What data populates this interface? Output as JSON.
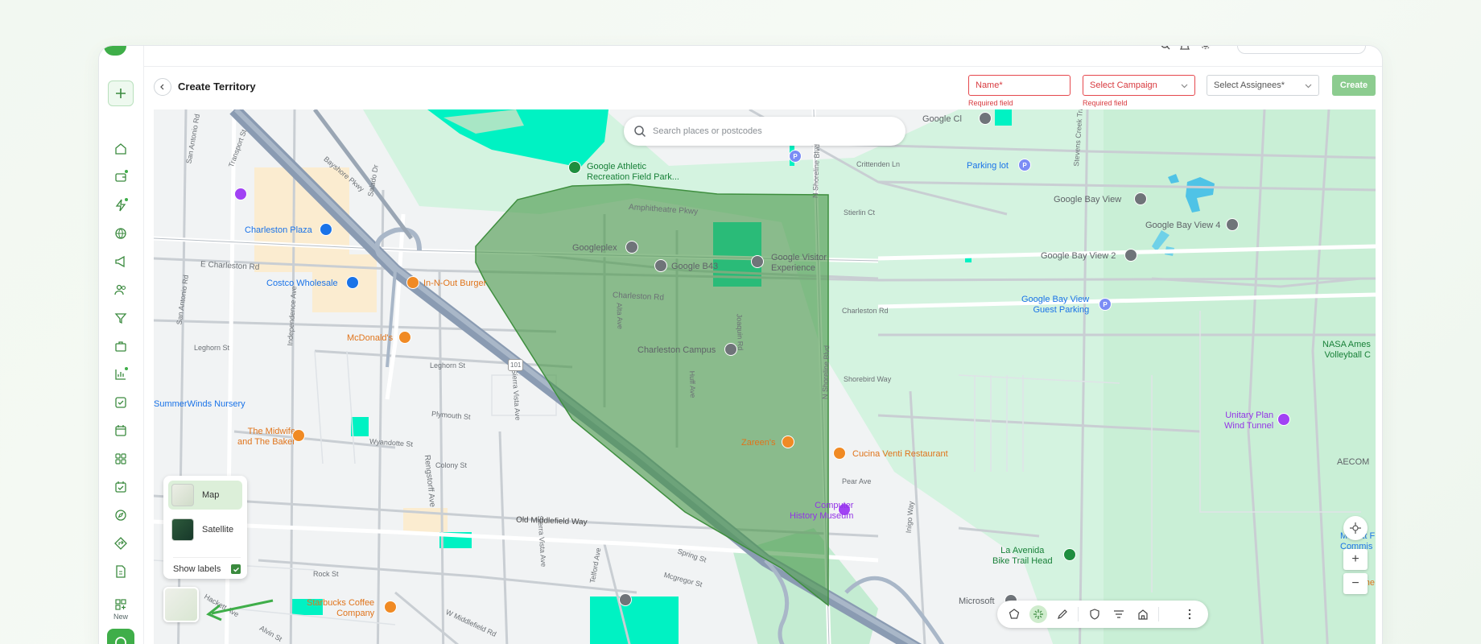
{
  "header": {
    "title": "Create Territory",
    "name_placeholder": "Name*",
    "name_error": "Required field",
    "campaign_placeholder": "Select Campaign",
    "campaign_error": "Required field",
    "assignees_placeholder": "Select Assignees*",
    "create_label": "Create"
  },
  "sidebar": {
    "items": [
      {
        "icon": "home-icon"
      },
      {
        "icon": "wallet-icon",
        "badge": true
      },
      {
        "icon": "lightning-icon",
        "badge": true
      },
      {
        "icon": "globe-icon"
      },
      {
        "icon": "megaphone-icon"
      },
      {
        "icon": "users-icon"
      },
      {
        "icon": "filter-icon"
      },
      {
        "icon": "briefcase-icon"
      },
      {
        "icon": "chart-icon",
        "badge": true
      },
      {
        "icon": "checkbox-icon"
      },
      {
        "icon": "calendar-icon"
      },
      {
        "icon": "grid-icon"
      },
      {
        "icon": "calendar-check-icon"
      },
      {
        "icon": "compass-icon"
      },
      {
        "icon": "directions-icon"
      },
      {
        "icon": "document-icon"
      }
    ],
    "new_label": "New"
  },
  "map": {
    "search_placeholder": "Search places or postcodes",
    "places": {
      "google_athletic": "Google Athletic\nRecreation Field Park...",
      "googleplex": "Googleplex",
      "google_b43": "Google B43",
      "google_visitor": "Google Visitor\nExperience",
      "charleston_campus": "Charleston Campus",
      "zareens": "Zareen's",
      "computer_history": "Computer\nHistory Museum",
      "cucina_venti": "Cucina Venti Restaurant",
      "charleston_plaza": "Charleston Plaza",
      "costco": "Costco Wholesale",
      "in_n_out": "In-N-Out Burger",
      "mcdonalds": "McDonald's",
      "summerwinds": "SummerWinds Nursery",
      "midwife": "The Midwife\nand The Baker",
      "starbucks": "Starbucks Coffee\nCompany",
      "google_cl": "Google Cl",
      "parking_lot": "Parking lot",
      "google_bay_view": "Google Bay View",
      "google_bay_view_4": "Google Bay View 4",
      "google_bay_view_2": "Google Bay View 2",
      "google_bay_view_guest": "Google Bay View\nGuest Parking",
      "nasa_ames": "NASA Ames\nVolleyball C",
      "unitary_plan": "Unitary Plan\nWind Tunnel",
      "aecom": "AECOM",
      "la_avenida": "La Avenida\nBike Trail Head",
      "microsoft": "Microsoft",
      "moffett": "Moffett F\nCommis",
      "the": "The"
    },
    "streets": {
      "bayshore": "Bayshore Pkwy",
      "amphitheatre": "Amphitheatre Pkwy",
      "charleston_rd": "Charleston Rd",
      "charleston_rd_e": "Charleston Rd",
      "e_charleston": "E Charleston Rd",
      "san_antonio": "San Antonio Rd",
      "san_antonio_top": "San Antonio Rd",
      "transport": "Transport St",
      "salado": "Salado Dr",
      "independence": "Independence Ave",
      "leghorn": "Leghorn St",
      "leghorn_e": "Leghorn St",
      "plymouth": "Plymouth St",
      "wyandotte": "Wyandotte St",
      "colony": "Colony St",
      "rengstorff": "Rengstorff Ave",
      "sierra_vista": "Sierra Vista Ave",
      "sierra_vista_s": "Sierra Vista Ave",
      "alta": "Alta Ave",
      "huff": "Huff Ave",
      "joaquin": "Joaquin Rd",
      "n_shoreline": "N Shoreline Blvd",
      "n_shoreline_top": "N Shoreline Blvd",
      "crittenden": "Crittenden Ln",
      "stierlin": "Stierlin Ct",
      "shorebird": "Shorebird Way",
      "pear": "Pear Ave",
      "inigo": "Inigo Way",
      "old_middlefield": "Old Middlefield Way",
      "w_middlefield": "W Middlefield Rd",
      "spring": "Spring St",
      "mcgregor": "Mcgregor St",
      "telford": "Telford Ave",
      "rock": "Rock St",
      "alvin": "Alvin St",
      "hackett": "Hackett Ave",
      "stevens_creek": "Stevens Creek Trail",
      "highway_101": "101",
      "fairway": "Fairway Dr"
    },
    "layers": {
      "map_label": "Map",
      "satellite_label": "Satellite",
      "show_labels": "Show labels",
      "show_labels_checked": true,
      "toggle_label": "Map"
    },
    "territory_color": "#5aa25a",
    "zoom_in": "+",
    "zoom_out": "−"
  },
  "toolbar": {
    "tools": [
      "polygon-icon",
      "sparkle-icon",
      "pencil-icon",
      "shield-pin-icon",
      "filter-lines-icon",
      "house-icon",
      "more-icon"
    ]
  },
  "colors": {
    "accent": "#3fae49",
    "error": "#e5484d",
    "park": "#c8efd9",
    "water": "#00f2c3"
  }
}
